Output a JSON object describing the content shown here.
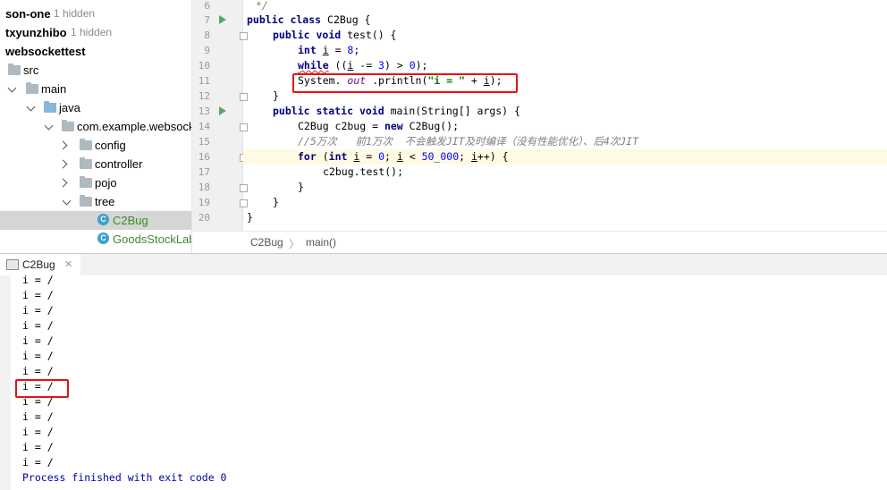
{
  "tree": {
    "items": [
      {
        "label": "son-one",
        "hint": "1 hidden"
      },
      {
        "label": "txyunzhibo",
        "hint": "1 hidden"
      },
      {
        "label": "websockettest"
      },
      {
        "label": "src"
      },
      {
        "label": "main"
      },
      {
        "label": "java"
      },
      {
        "label": "com.example.websocket"
      },
      {
        "label": "config"
      },
      {
        "label": "controller"
      },
      {
        "label": "pojo"
      },
      {
        "label": "tree"
      },
      {
        "label": "C2Bug"
      },
      {
        "label": "GoodsStockLabel"
      }
    ]
  },
  "editor": {
    "lines": [
      {
        "num": "6"
      },
      {
        "num": "7"
      },
      {
        "num": "8"
      },
      {
        "num": "9"
      },
      {
        "num": "10"
      },
      {
        "num": "11"
      },
      {
        "num": "12"
      },
      {
        "num": "13"
      },
      {
        "num": "14"
      },
      {
        "num": "15"
      },
      {
        "num": "16"
      },
      {
        "num": "17"
      },
      {
        "num": "18"
      },
      {
        "num": "19"
      },
      {
        "num": "20"
      }
    ],
    "code": {
      "l6": "*/",
      "l7a": "public class ",
      "l7b": "C2Bug {",
      "l8a": "public ",
      "l8b": "void ",
      "l8c": "test() {",
      "l9a": "int ",
      "l9b": "i",
      "l9c": " = ",
      "l9d": "8",
      "l9e": ";",
      "l10a": "while",
      "l10b": " ((",
      "l10c": "i",
      "l10d": " -= ",
      "l10e": "3",
      "l10f": ") > ",
      "l10g": "0",
      "l10h": ");",
      "l11a": "System. ",
      "l11b": "out",
      "l11c": " .println(",
      "l11d": "\"i = \"",
      "l11e": " + ",
      "l11f": "i",
      "l11g": ");",
      "l12": "}",
      "l13a": "public static ",
      "l13b": "void ",
      "l13c": "main(String[] args) {",
      "l14a": "C2Bug c2bug = ",
      "l14b": "new ",
      "l14c": "C2Bug();",
      "l15": "//5万次   前1万次  不会触发JIT及时编译（没有性能优化）、后4次JIT",
      "l16a": "for ",
      "l16b": "(",
      "l16c": "int ",
      "l16d": "i",
      "l16e": " = ",
      "l16f": "0",
      "l16g": "; ",
      "l16h": "i",
      "l16i": " < ",
      "l16j": "50_000",
      "l16k": "; ",
      "l16l": "i",
      "l16m": "++) {",
      "l17": "c2bug.test();",
      "l18": "}",
      "l19": "}",
      "l20": "}"
    }
  },
  "breadcrumb": {
    "class": "C2Bug",
    "sep": "〉",
    "method": "main()"
  },
  "run": {
    "tab_label": "C2Bug",
    "output": [
      "i = /",
      "i = /",
      "i = /",
      "i = /",
      "i = /",
      "i = /",
      "i = /",
      "i = /",
      "i = /",
      "i = /",
      "i = /",
      "i = /",
      "i = /"
    ],
    "finished": "Process finished with exit code 0"
  },
  "colors": {
    "highlight_box": "#e5131a",
    "run_arrow": "#59a869"
  }
}
